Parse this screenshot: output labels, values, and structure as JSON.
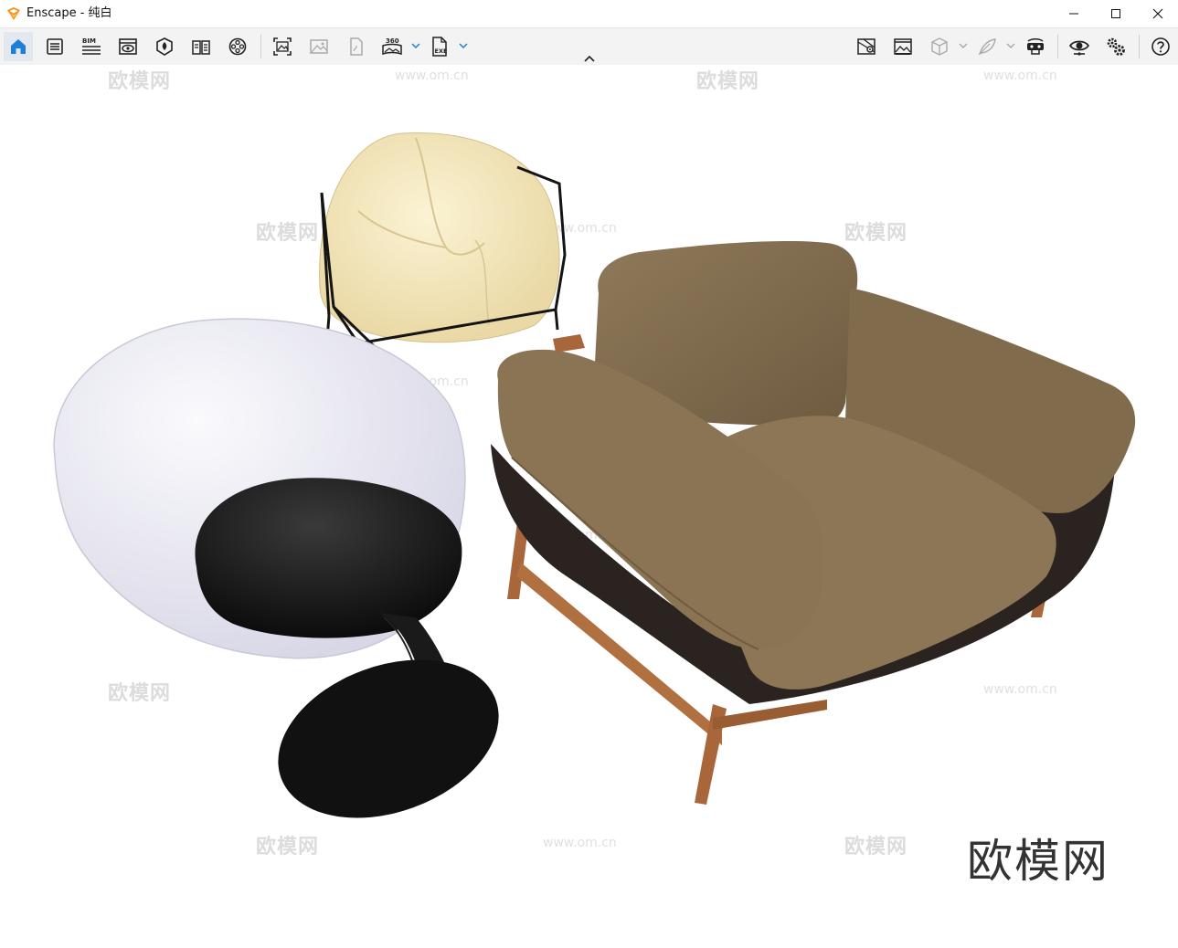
{
  "window": {
    "app_name": "Enscape",
    "title": "Enscape - 纯白",
    "minimize": "minimize",
    "maximize": "maximize",
    "close": "close"
  },
  "toolbar": {
    "left_items": [
      {
        "name": "home",
        "icon": "home-icon",
        "active": true
      },
      {
        "name": "settings-list",
        "icon": "document-list-icon"
      },
      {
        "name": "bim",
        "icon": "bim-icon",
        "label": "BIM"
      },
      {
        "name": "view-management",
        "icon": "eye-window-icon"
      },
      {
        "name": "asset-library",
        "icon": "asset-library-icon"
      },
      {
        "name": "material-editor",
        "icon": "book-icon"
      },
      {
        "name": "video-editor",
        "icon": "film-reel-icon"
      },
      {
        "name": "screenshot",
        "icon": "screenshot-icon"
      },
      {
        "name": "batch-render",
        "icon": "image-icon"
      },
      {
        "name": "sketch",
        "icon": "sketch-icon"
      },
      {
        "name": "panorama",
        "icon": "panorama-360-icon",
        "label": "360"
      },
      {
        "name": "exe-export",
        "icon": "exe-file-icon",
        "label": "EXE"
      }
    ],
    "right_items": [
      {
        "name": "map",
        "icon": "map-icon"
      },
      {
        "name": "render-window",
        "icon": "render-window-icon"
      },
      {
        "name": "cube-view",
        "icon": "cube-icon"
      },
      {
        "name": "feather",
        "icon": "feather-icon"
      },
      {
        "name": "vr-headset",
        "icon": "vr-headset-icon"
      },
      {
        "name": "visual-settings",
        "icon": "eye-icon"
      },
      {
        "name": "general-settings",
        "icon": "gears-icon"
      },
      {
        "name": "help",
        "icon": "help-icon"
      }
    ]
  },
  "viewport": {
    "watermark_text": "欧模网",
    "watermark_url": "www.om.cn",
    "brand_text": "欧模网"
  },
  "colors": {
    "accent": "#1e7fd6",
    "logo_orange": "#f7941d",
    "armchair_fabric": "#8a7455",
    "armchair_wood": "#a8663a",
    "cream_chair": "#f5eccb",
    "white_shell": "#f2f1f6",
    "black_seat": "#151515"
  }
}
